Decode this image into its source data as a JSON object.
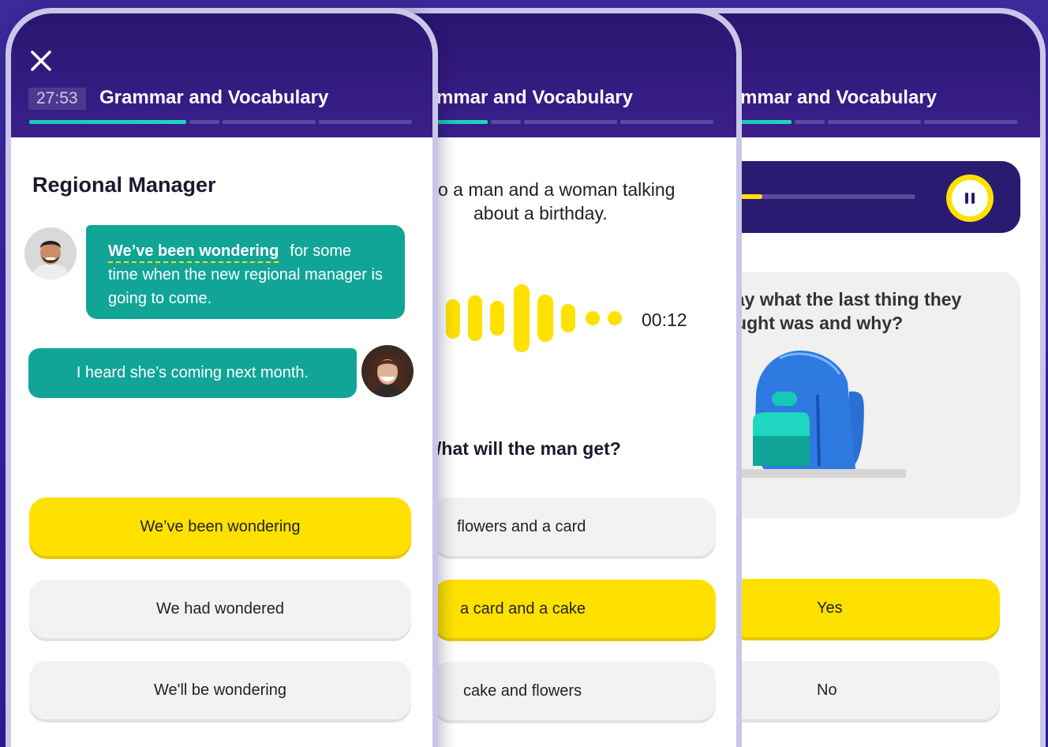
{
  "screens": [
    {
      "timer": "27:53",
      "title": "Grammar and Vocabulary",
      "role_title": "Regional Manager",
      "bubble1": {
        "highlight": "We’ve been wondering",
        "lead": "for some",
        "rest": "time when the new regional manager is going to come."
      },
      "bubble2": "I heard she’s coming next month.",
      "options": [
        "We’ve been wondering",
        "We had wondered",
        "We'll be wondering"
      ],
      "selected_option": "We’ve been wondering"
    },
    {
      "title": "mmar and Vocabulary",
      "description_line1": "o a man and a woman talking",
      "description_line2": "about a birthday.",
      "audio_time": "00:12",
      "question": "/hat will the man get?",
      "options": [
        "flowers and a card",
        "a card and a cake",
        "cake and flowers"
      ],
      "selected_option": "a card and a cake"
    },
    {
      "title": "mmar and Vocabulary",
      "question_line1": "say what the last thing they",
      "question_line2": "ought was and why?",
      "audio_progress_fraction": 0.2,
      "options": [
        "Yes",
        "No"
      ],
      "selected_option": "Yes"
    }
  ],
  "icons": {
    "close": "close-icon",
    "pause": "pause-icon",
    "backpack": "backpack-illustration"
  },
  "colors": {
    "header": "#2a1670",
    "teal_bubble": "#10a597",
    "progress": "#18c8b6",
    "selected_yellow": "#ffe100",
    "option_grey": "#f2f2f2",
    "background": "#3a2a9a"
  }
}
